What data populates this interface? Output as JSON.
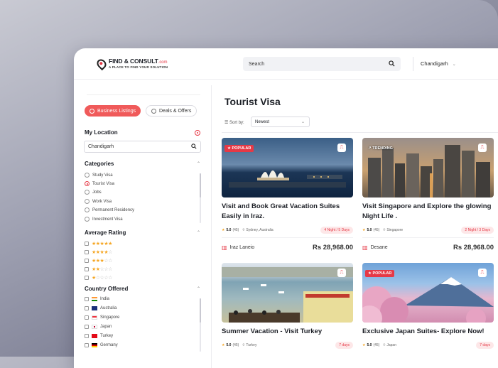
{
  "header": {
    "logo_name": "FIND & CONSULT",
    "logo_domain": ".com",
    "logo_tagline": "A PLACE TO FIND YOUR SOLUTION",
    "search_placeholder": "Search",
    "location": "Chandigarh"
  },
  "sidebar": {
    "tabs": [
      {
        "label": "Business Listings",
        "active": true
      },
      {
        "label": "Deals & Offers",
        "active": false
      }
    ],
    "my_location": {
      "title": "My Location",
      "value": "Chandigarh"
    },
    "categories": {
      "title": "Categories",
      "items": [
        {
          "label": "Study Visa",
          "selected": false
        },
        {
          "label": "Tourist Visa",
          "selected": true
        },
        {
          "label": "Jobs",
          "selected": false
        },
        {
          "label": "Work Visa",
          "selected": false
        },
        {
          "label": "Permanent Residency",
          "selected": false
        },
        {
          "label": "Investment Visa",
          "selected": false
        }
      ]
    },
    "rating": {
      "title": "Average Rating",
      "items": [
        5,
        4,
        3,
        2,
        1
      ]
    },
    "country": {
      "title": "Country Offered",
      "items": [
        {
          "label": "India",
          "flag": "india"
        },
        {
          "label": "Australia",
          "flag": "australia"
        },
        {
          "label": "Singapore",
          "flag": "singapore"
        },
        {
          "label": "Japan",
          "flag": "japan"
        },
        {
          "label": "Turkey",
          "flag": "turkey"
        },
        {
          "label": "Germany",
          "flag": "germany"
        }
      ]
    }
  },
  "main": {
    "title": "Tourist Visa",
    "sort_label": "Sort by:",
    "sort_value": "Newest",
    "cards": [
      {
        "badge": "POPULAR",
        "title": "Visit and Book Great Vacation Suites Easily in Iraz.",
        "rating": "5.0",
        "reviews": "(45)",
        "place": "Sydney, Australia",
        "duration": "4 Night / 5 Days",
        "vendor": "Iraz Laneio",
        "price": "Rs 28,968.00",
        "scene": "sydney"
      },
      {
        "badge": "TRENDING",
        "title": "Visit Singapore and Explore the glowing Night Life .",
        "rating": "5.0",
        "reviews": "(45)",
        "place": "Singapore",
        "duration": "2 Night / 3 Days",
        "vendor": "Desane",
        "price": "Rs 28,968.00",
        "scene": "city"
      },
      {
        "badge": "",
        "title": "Summer Vacation - Visit Turkey",
        "rating": "5.0",
        "reviews": "(45)",
        "place": "Turkey",
        "duration": "7 days",
        "vendor": "",
        "price": "",
        "scene": "harbor"
      },
      {
        "badge": "POPULAR",
        "title": "Exclusive Japan Suites- Explore Now!",
        "rating": "5.0",
        "reviews": "(45)",
        "place": "Japan",
        "duration": "7 days",
        "vendor": "",
        "price": "",
        "scene": "fuji"
      }
    ]
  }
}
